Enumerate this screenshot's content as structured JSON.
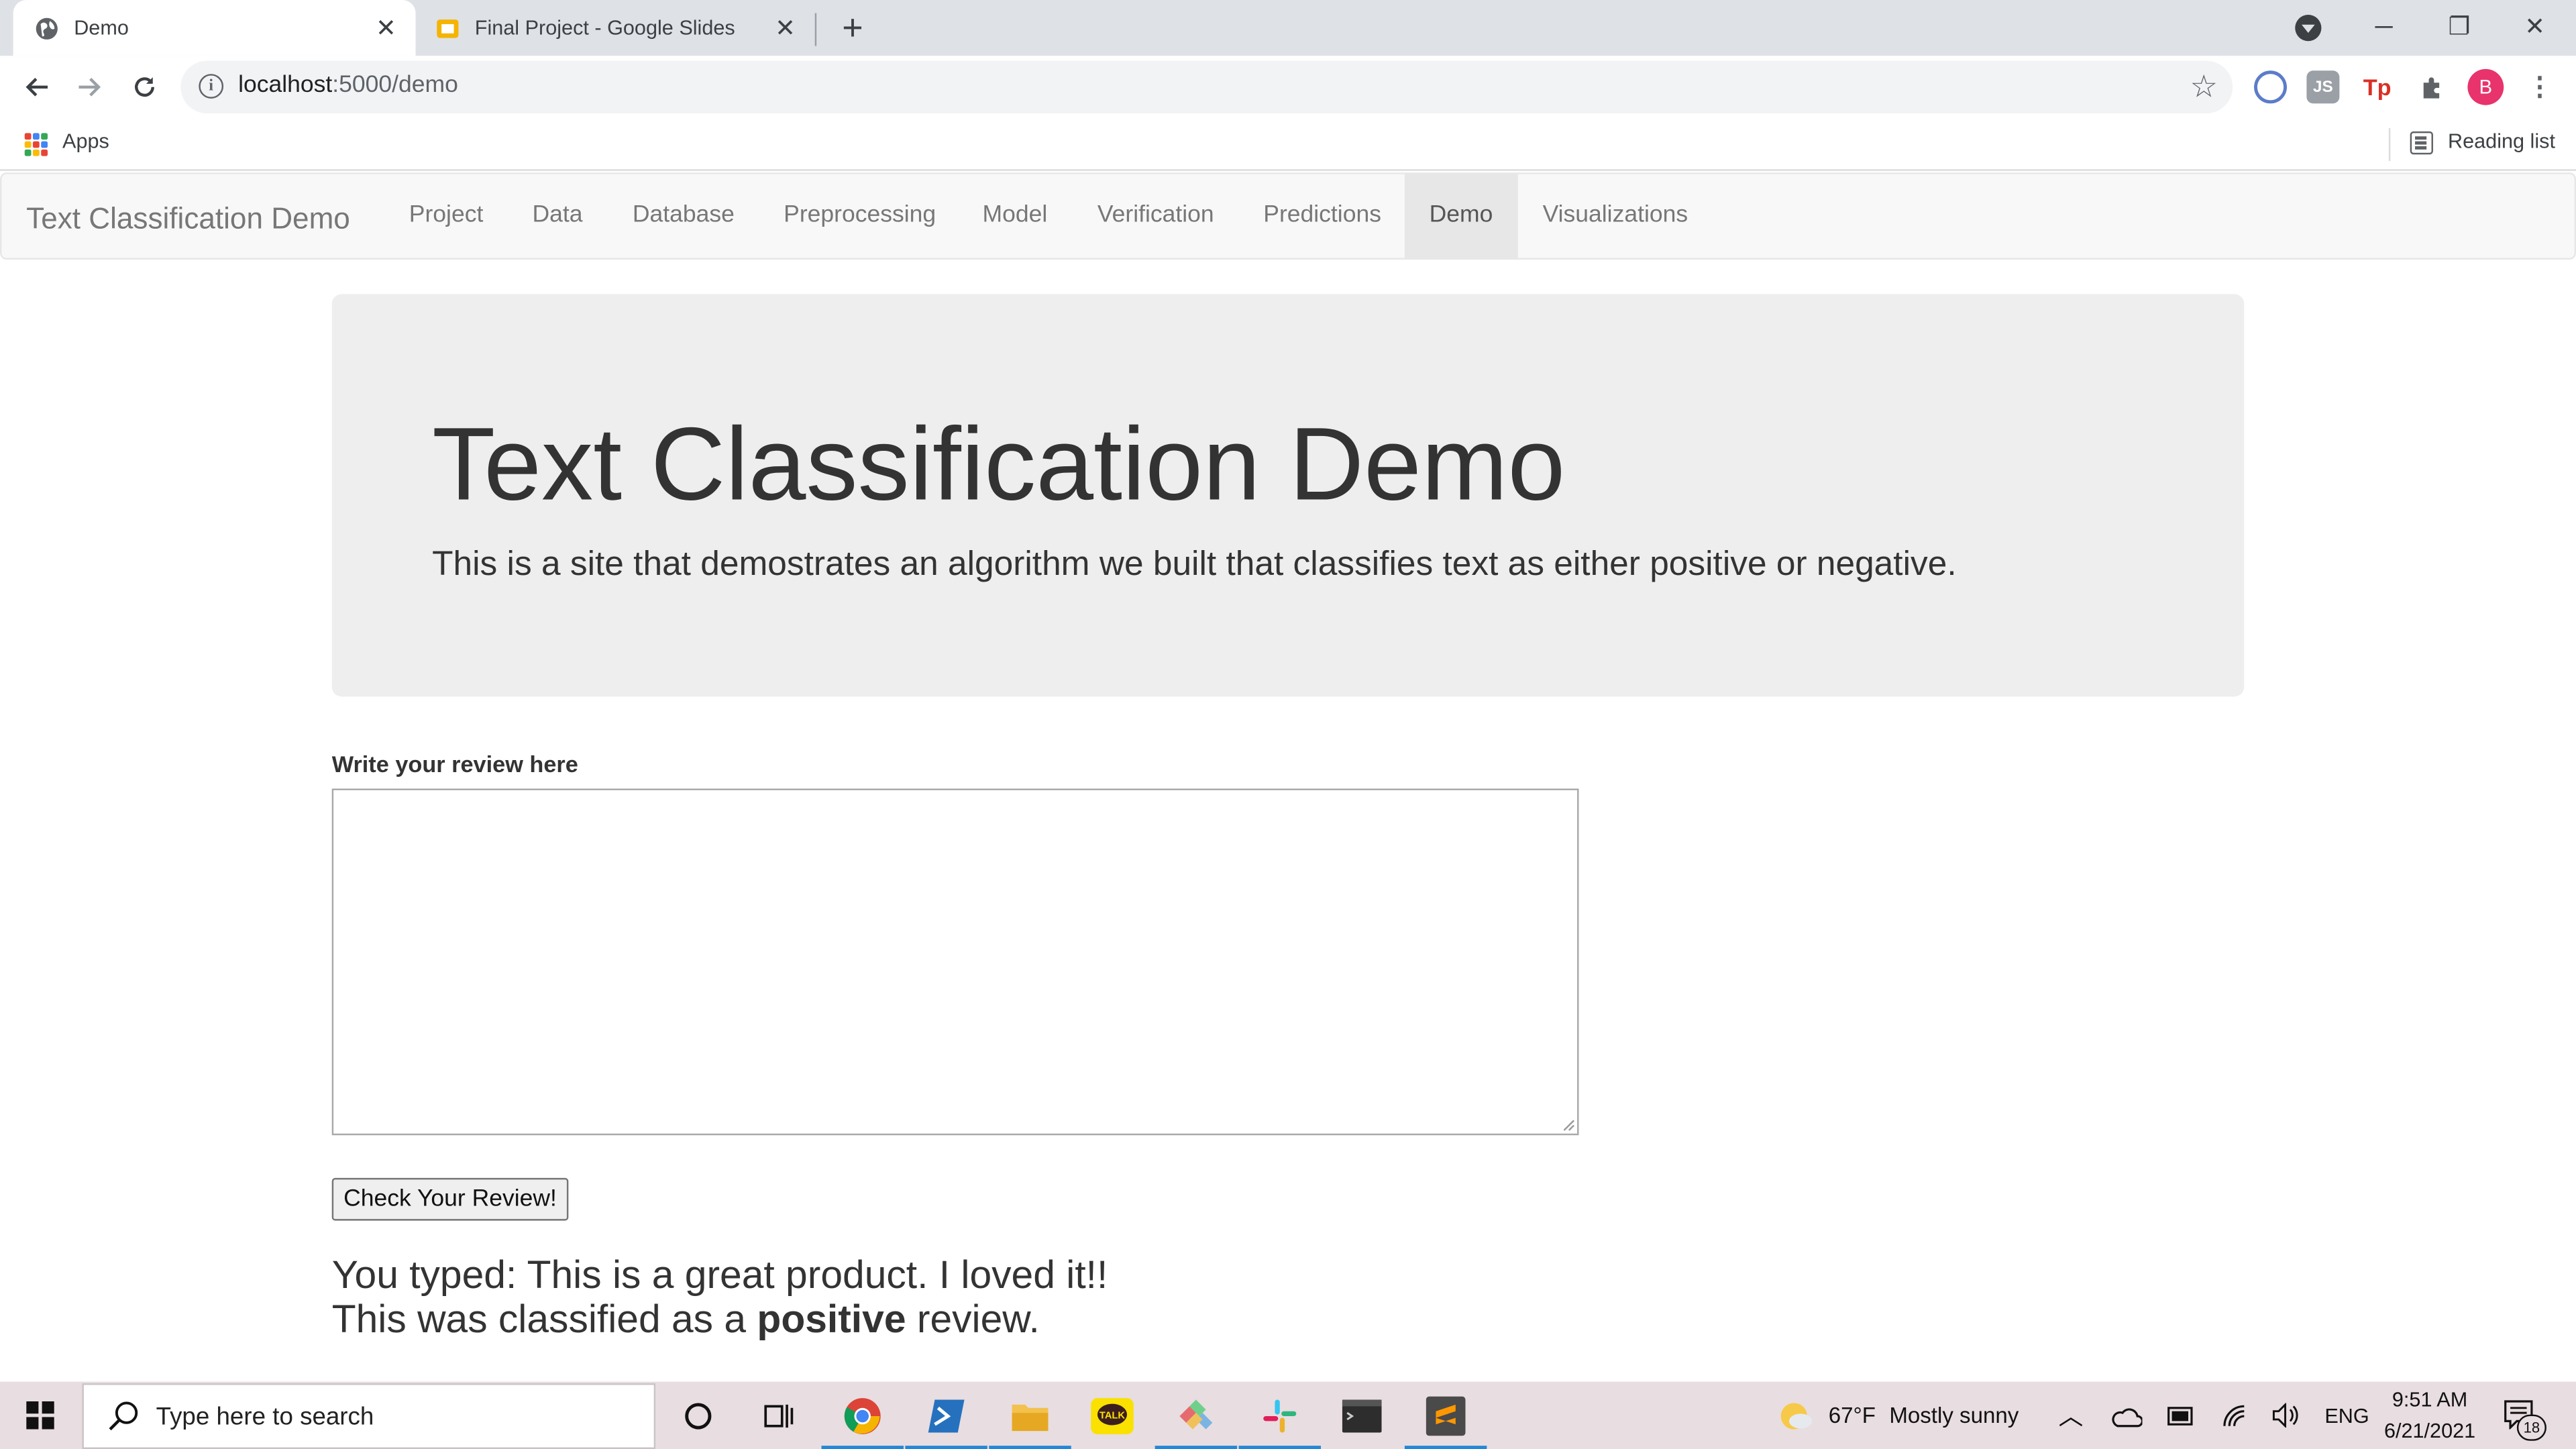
{
  "browser": {
    "tabs": [
      {
        "title": "Demo",
        "active": true
      },
      {
        "title": "Final Project - Google Slides",
        "active": false
      }
    ],
    "url_host": "localhost",
    "url_path": ":5000/demo",
    "profile_initial": "B",
    "bookmarks": {
      "apps_label": "Apps",
      "reading_list_label": "Reading list"
    }
  },
  "navbar": {
    "brand": "Text Classification Demo",
    "items": [
      {
        "label": "Project"
      },
      {
        "label": "Data"
      },
      {
        "label": "Database"
      },
      {
        "label": "Preprocessing"
      },
      {
        "label": "Model"
      },
      {
        "label": "Verification"
      },
      {
        "label": "Predictions"
      },
      {
        "label": "Demo",
        "active": true
      },
      {
        "label": "Visualizations"
      }
    ]
  },
  "jumbotron": {
    "title": "Text Classification Demo",
    "subtitle": "This is a site that demostrates an algorithm we built that classifies text as either positive or negative."
  },
  "form": {
    "label": "Write your review here",
    "value": "",
    "button_label": "Check Your Review!"
  },
  "result": {
    "typed_prefix": "You typed: ",
    "typed_text": "This is a great product. I loved it!!",
    "classified_prefix": "This was classified as a ",
    "sentiment": "positive",
    "classified_suffix": " review."
  },
  "taskbar": {
    "search_placeholder": "Type here to search",
    "weather_temp": "67°F",
    "weather_desc": "Mostly sunny",
    "language": "ENG",
    "time": "9:51 AM",
    "date": "6/21/2021",
    "notification_count": "18"
  },
  "colors": {
    "navbar_bg": "#f8f8f8",
    "jumbotron_bg": "#eeeeee",
    "tab_strip": "#dee1e6",
    "taskbar_bg": "#e8dde0"
  }
}
